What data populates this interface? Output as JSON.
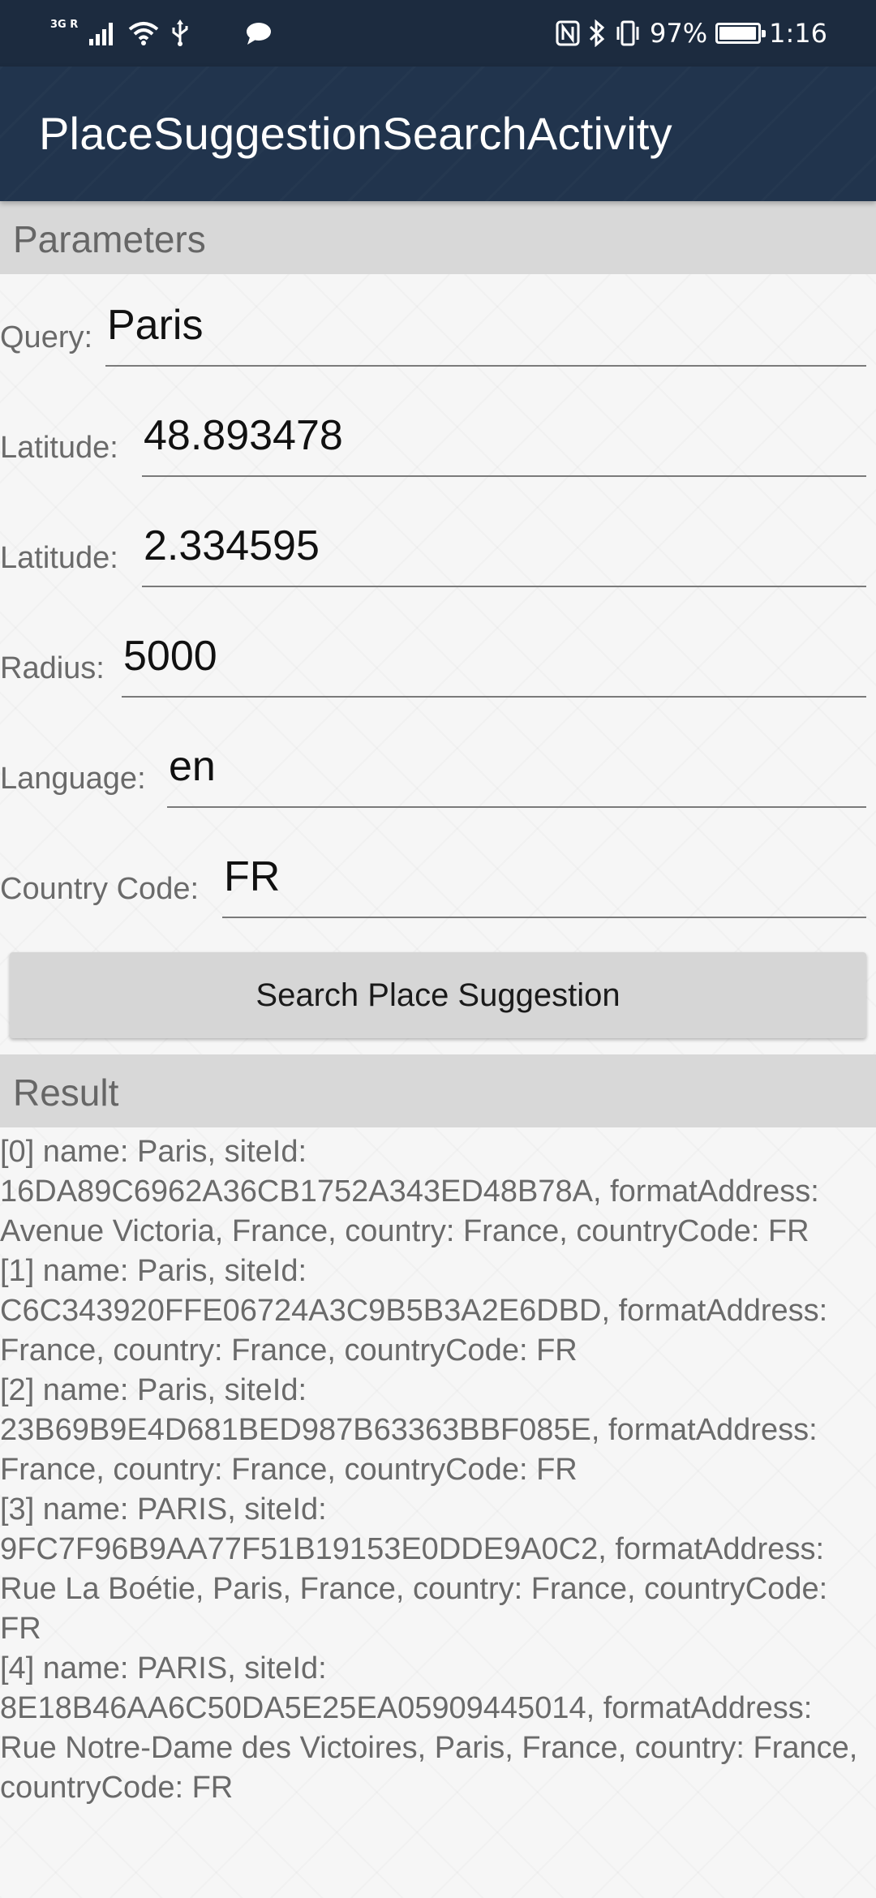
{
  "status_bar": {
    "network": "3G R",
    "battery": "97%",
    "battery_level": 0.97,
    "time": "1:16",
    "icons": [
      "signal-icon",
      "wifi-icon",
      "usb-icon",
      "chat-icon",
      "nfc-icon",
      "bluetooth-icon",
      "vibrate-icon",
      "battery-icon"
    ]
  },
  "app_bar": {
    "title": "PlaceSuggestionSearchActivity",
    "color": "#21344d"
  },
  "parameters": {
    "header": "Parameters",
    "query_label": "Query:",
    "query_value": "Paris",
    "latitude_label": "Latitude:",
    "latitude_value": "48.893478",
    "longitude_label": "Latitude:",
    "longitude_value": "2.334595",
    "radius_label": "Radius:",
    "radius_value": "5000",
    "language_label": "Language:",
    "language_value": "en",
    "country_code_label": "Country Code:",
    "country_code_value": "FR"
  },
  "search_button": {
    "label": "Search Place Suggestion"
  },
  "result": {
    "header": "Result",
    "lines": [
      "[0] name: Paris, siteId: 16DA89C6962A36CB1752A343ED48B78A, formatAddress: Avenue Victoria, France, country: France, countryCode: FR",
      "[1] name: Paris, siteId: C6C343920FFE06724A3C9B5B3A2E6DBD, formatAddress: France, country: France, countryCode: FR",
      "[2] name: Paris, siteId: 23B69B9E4D681BED987B63363BBF085E, formatAddress: France, country: France, countryCode: FR",
      "[3] name: PARIS, siteId: 9FC7F96B9AA77F51B19153E0DDE9A0C2, formatAddress: Rue La Boétie, Paris, France, country: France, countryCode: FR",
      "[4] name: PARIS, siteId: 8E18B46AA6C50DA5E25EA05909445014, formatAddress: Rue Notre-Dame des Victoires, Paris, France, country: France, countryCode: FR"
    ]
  }
}
